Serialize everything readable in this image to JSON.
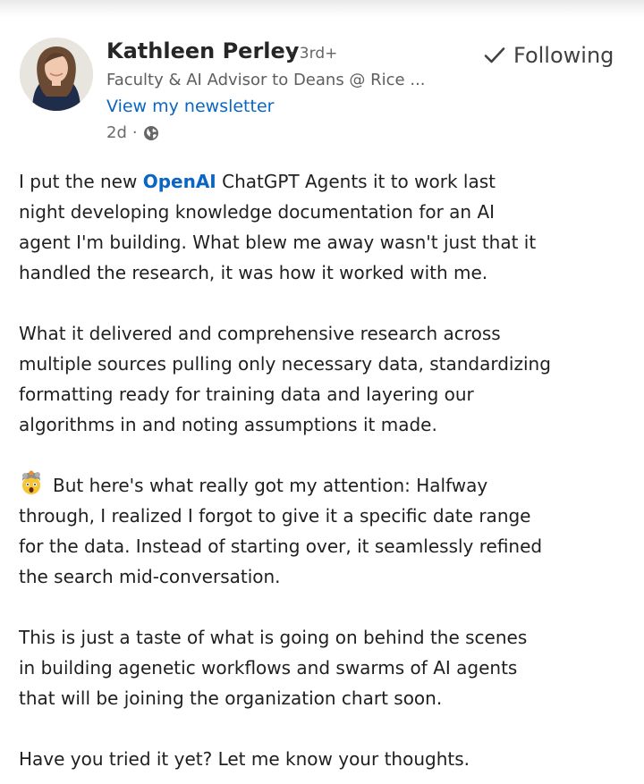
{
  "post": {
    "author": {
      "name": "Kathleen Perley",
      "degree": "· 3rd+",
      "headline": "Faculty & AI Advisor to Deans @ Rice ...",
      "newsletter_link": "View my newsletter",
      "time_ago": "2d",
      "separator": "·",
      "visibility_icon": "globe-icon"
    },
    "follow_button": {
      "label": "Following",
      "icon": "checkmark-icon"
    },
    "body": {
      "p1": {
        "l1_a": "I put the new ",
        "mention": "OpenAI",
        "l1_b": " ChatGPT Agents  it to work last",
        "l2": "night developing knowledge documentation for an AI",
        "l3": "agent I'm building. What blew me away wasn't just that it",
        "l4": "handled the research, it was how it worked with me."
      },
      "p2": {
        "l1": "What it delivered and comprehensive research across",
        "l2": "multiple sources pulling only necessary data, standardizing",
        "l3": "formatting ready for training data and layering our",
        "l4": "algorithms in and noting assumptions it made."
      },
      "p3": {
        "emoji": "exploding-head-emoji",
        "l1": "But here's what really got my attention: Halfway",
        "l2": "through, I realized I forgot to give it a specific date range",
        "l3": "for the data. Instead of starting over, it seamlessly refined",
        "l4": "the search mid-conversation."
      },
      "p4": {
        "l1": "This is just a taste of what is going on behind the scenes",
        "l2": "in building agenetic workflows and swarms of AI agents",
        "l3": "that will be joining the organization chart soon."
      },
      "p5": {
        "l1": "Have you tried it yet? Let me know your thoughts."
      }
    }
  },
  "colors": {
    "link_blue": "#0a66c2",
    "text_primary": "#1f1f1f",
    "text_secondary": "#666666"
  }
}
